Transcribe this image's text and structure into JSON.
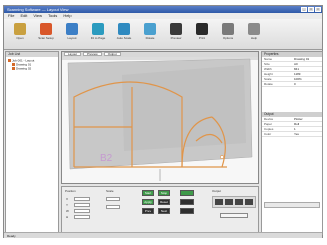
{
  "window": {
    "title": "Scanning Software — Layout View"
  },
  "menu": [
    "File",
    "Edit",
    "View",
    "Tools",
    "Help"
  ],
  "toolbar": [
    {
      "label": "Open",
      "icon": "folder-icon",
      "color": "#c9a040"
    },
    {
      "label": "Scan Setup",
      "icon": "scanner-icon",
      "color": "#d9572a"
    },
    {
      "label": "Layout",
      "icon": "layout-icon",
      "color": "#3c7fc6"
    },
    {
      "label": "Fit to Page",
      "icon": "fit-icon",
      "color": "#2b9bbf"
    },
    {
      "label": "Auto Scale",
      "icon": "scale-icon",
      "color": "#2f8ac0"
    },
    {
      "label": "Rotate",
      "icon": "rotate-icon",
      "color": "#4aa0cf"
    },
    {
      "label": "Preview",
      "icon": "preview-icon",
      "color": "#3a3a3a"
    },
    {
      "label": "Print",
      "icon": "print-icon",
      "color": "#2a2a2a"
    },
    {
      "label": "Options",
      "icon": "options-icon",
      "color": "#7a7a7a"
    },
    {
      "label": "Help",
      "icon": "help-icon",
      "color": "#8a8a8a"
    }
  ],
  "left_panel": {
    "title": "Job List",
    "items": [
      "Job 001 - Layout",
      "Drawing 01",
      "Drawing 02"
    ]
  },
  "canvas": {
    "tabs": [
      "Layout",
      "Preview",
      "Output"
    ],
    "shape_label": "B2"
  },
  "controls": {
    "section1": "Position",
    "section2": "Scale",
    "section3": "Output",
    "fields": [
      "X",
      "Y",
      "W",
      "H"
    ],
    "buttons": [
      "Start",
      "Stop",
      "Apply",
      "Reset",
      "Prev",
      "Next"
    ]
  },
  "right_panel": {
    "header": "Properties",
    "rows": [
      {
        "k": "Name",
        "v": "Drawing 01"
      },
      {
        "k": "Size",
        "v": "A0"
      },
      {
        "k": "Width",
        "v": "841"
      },
      {
        "k": "Height",
        "v": "1189"
      },
      {
        "k": "Scale",
        "v": "100%"
      },
      {
        "k": "Rotate",
        "v": "0"
      }
    ],
    "header2": "Output",
    "rows2": [
      {
        "k": "Device",
        "v": "Plotter"
      },
      {
        "k": "Paper",
        "v": "Roll"
      },
      {
        "k": "Copies",
        "v": "1"
      },
      {
        "k": "Color",
        "v": "Yes"
      }
    ]
  },
  "status": {
    "text": "Ready"
  }
}
